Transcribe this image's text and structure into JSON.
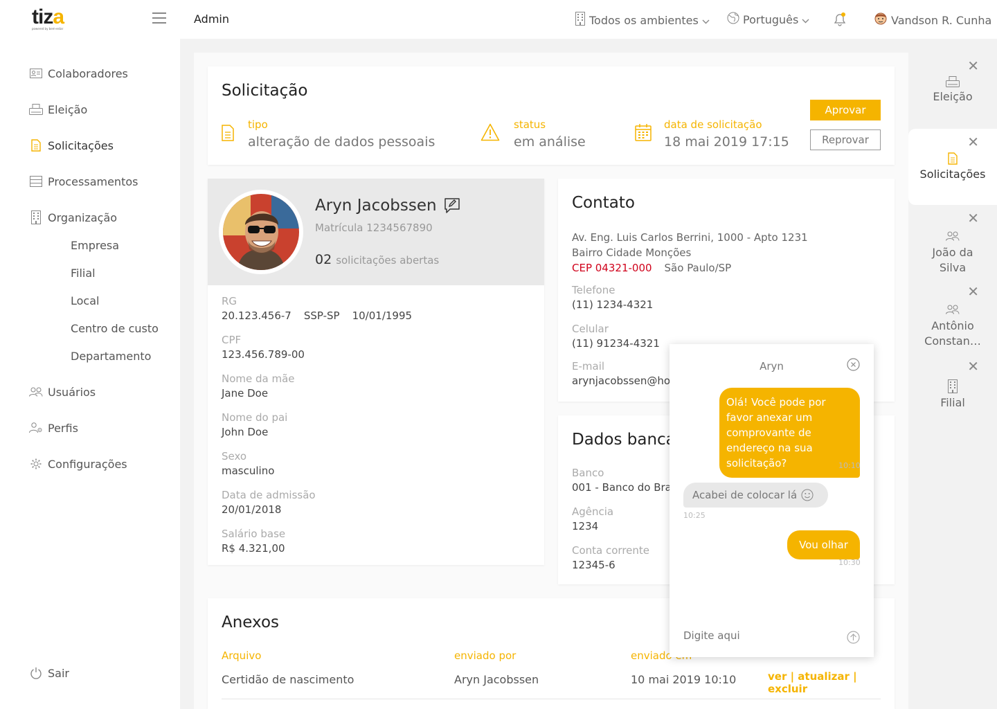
{
  "brand": {
    "logo": "tiza",
    "logo_sub": "powered by bem-estar"
  },
  "sidebar": {
    "items": [
      {
        "label": "Colaboradores",
        "icon": "id-card-icon"
      },
      {
        "label": "Eleição",
        "icon": "printer-icon"
      },
      {
        "label": "Solicitações",
        "icon": "document-icon"
      },
      {
        "label": "Processamentos",
        "icon": "server-icon"
      },
      {
        "label": "Organização",
        "icon": "building-icon"
      }
    ],
    "sub_items": [
      "Empresa",
      "Filial",
      "Local",
      "Centro de custo",
      "Departamento"
    ],
    "items2": [
      {
        "label": "Usuários",
        "icon": "users-icon"
      },
      {
        "label": "Perfis",
        "icon": "user-settings-icon"
      },
      {
        "label": "Configurações",
        "icon": "gear-icon"
      }
    ],
    "logout": "Sair"
  },
  "topbar": {
    "title": "Admin",
    "environments": "Todos os ambientes",
    "language": "Português",
    "user": "Vandson R. Cunha"
  },
  "request": {
    "title": "Solicitação",
    "type_label": "tipo",
    "type_value": "alteração de dados pessoais",
    "status_label": "status",
    "status_value": "em análise",
    "date_label": "data de solicitação",
    "date_value": "18 mai 2019 17:15",
    "approve": "Aprovar",
    "reject": "Reprovar"
  },
  "profile": {
    "name": "Aryn Jacobssen",
    "registration": "Matrícula 1234567890",
    "open_count": "02",
    "open_label": "solicitações abertas",
    "rg_label": "RG",
    "rg_number": "20.123.456-7",
    "rg_issuer": "SSP-SP",
    "rg_date": "10/01/1995",
    "cpf_label": "CPF",
    "cpf": "123.456.789-00",
    "mother_label": "Nome da mãe",
    "mother": "Jane Doe",
    "father_label": "Nome do pai",
    "father": "John Doe",
    "sex_label": "Sexo",
    "sex": "masculino",
    "admission_label": "Data de admissão",
    "admission": "20/01/2018",
    "salary_label": "Salário base",
    "salary": "R$ 4.321,00"
  },
  "contact": {
    "title": "Contato",
    "address1": "Av. Eng. Luis Carlos Berrini, 1000 - Apto 1231",
    "address2": "Bairro Cidade Monções",
    "cep": "CEP 04321-000",
    "city": "São Paulo/SP",
    "phone_label": "Telefone",
    "phone": "(11) 1234-4321",
    "mobile_label": "Celular",
    "mobile": "(11) 91234-4321",
    "email_label": "E-mail",
    "email": "arynjacobssen@hotmail.com"
  },
  "bank": {
    "title": "Dados bancários",
    "bank_label": "Banco",
    "bank": "001 - Banco do Brasil",
    "agency_label": "Agência",
    "agency": "1234",
    "account_label": "Conta corrente",
    "account": "12345-6"
  },
  "attachments": {
    "title": "Anexos",
    "col_file": "Arquivo",
    "col_sent_by": "enviado por",
    "col_sent_at": "enviado em",
    "rows": [
      {
        "file": "Certidão de nascimento",
        "sent_by": "Aryn Jacobssen",
        "sent_at": "10 mai 2019 10:10",
        "actions": "ver | atualizar | excluir"
      }
    ]
  },
  "right_panel": {
    "items": [
      {
        "label": "Eleição",
        "icon": "printer-icon"
      },
      {
        "label": "Solicitações",
        "icon": "document-icon"
      },
      {
        "label": "João da Silva",
        "icon": "users-icon"
      },
      {
        "label": "Antônio Constan…",
        "icon": "users-icon"
      },
      {
        "label": "Filial",
        "icon": "building-icon"
      }
    ]
  },
  "chat": {
    "name": "Aryn",
    "messages": [
      {
        "from": "me",
        "text": "Olá! Você pode por favor anexar um comprovante de endereço na sua solicitação?",
        "time": "10:10"
      },
      {
        "from": "other",
        "text": "Acabei de colocar lá",
        "time": "10:25"
      },
      {
        "from": "me",
        "text": "Vou olhar",
        "time": "10:30"
      }
    ],
    "placeholder": "Digite aqui"
  },
  "colors": {
    "accent": "#f5b400",
    "alert": "#d0021b"
  }
}
